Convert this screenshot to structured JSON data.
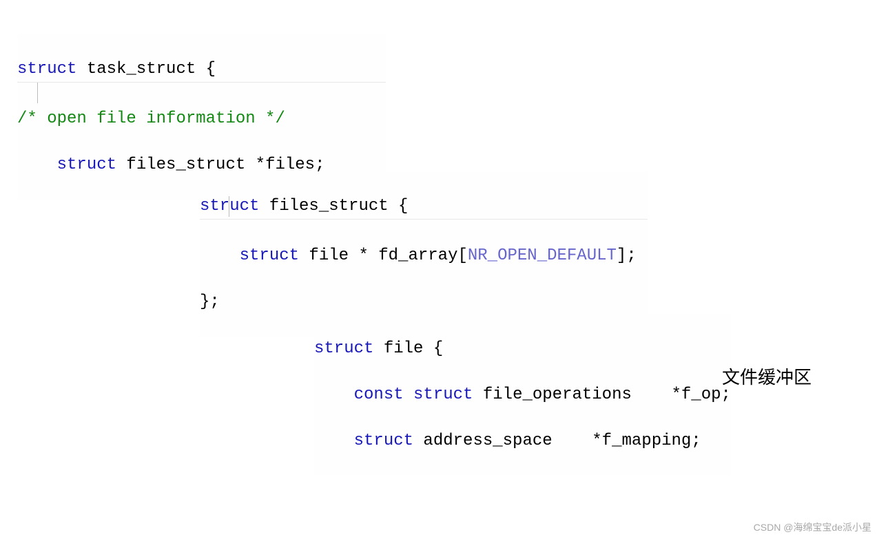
{
  "colors": {
    "keyword": "#1818b8",
    "comment": "#138813",
    "constant": "#6666cc"
  },
  "block1": {
    "kw_struct1": "struct",
    "name1": " task_struct {",
    "comment": "/* open file information */",
    "kw_struct2": "struct",
    "name2": " files_struct *files;"
  },
  "block2": {
    "kw_struct1": "struct",
    "name1": " files_struct {",
    "kw_struct2": "struct",
    "name2": " file * fd_array[",
    "constant": "NR_OPEN_DEFAULT",
    "name3": "];",
    "close": "};"
  },
  "block3": {
    "kw_struct1": "struct",
    "name1": " file {",
    "kw_const": "const",
    "kw_struct2": "struct",
    "name2": " file_operations    *f_op;",
    "kw_struct3": "struct",
    "name3": " address_space    *f_mapping;"
  },
  "label": "文件缓冲区",
  "watermark": "CSDN @海绵宝宝de派小星"
}
